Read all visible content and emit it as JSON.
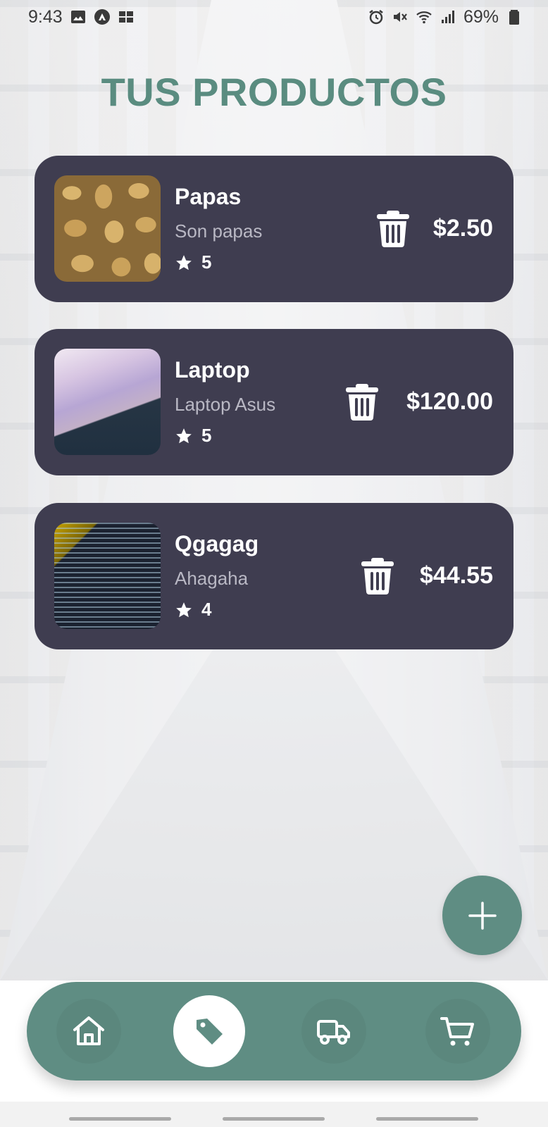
{
  "status_bar": {
    "time": "9:43",
    "battery": "69%"
  },
  "page": {
    "title": "TUS PRODUCTOS"
  },
  "products": [
    {
      "name": "Papas",
      "description": "Son papas",
      "rating": "5",
      "price": "$2.50",
      "thumbnail": "potatoes-photo"
    },
    {
      "name": "Laptop",
      "description": "Laptop Asus",
      "rating": "5",
      "price": "$120.00",
      "thumbnail": "laptop-photo"
    },
    {
      "name": "Qgagag",
      "description": "Ahagaha",
      "rating": "4",
      "price": "$44.55",
      "thumbnail": "code-screen-photo"
    }
  ],
  "fab": {
    "icon": "plus-icon"
  },
  "bottom_nav": {
    "items": [
      {
        "icon": "home-icon",
        "active": false
      },
      {
        "icon": "tag-icon",
        "active": true
      },
      {
        "icon": "truck-icon",
        "active": false
      },
      {
        "icon": "cart-icon",
        "active": false
      }
    ]
  },
  "colors": {
    "accent": "#5f8d83",
    "title": "#5a8c80",
    "card": "#3f3d50",
    "card_subtext": "#b9b8c4"
  }
}
